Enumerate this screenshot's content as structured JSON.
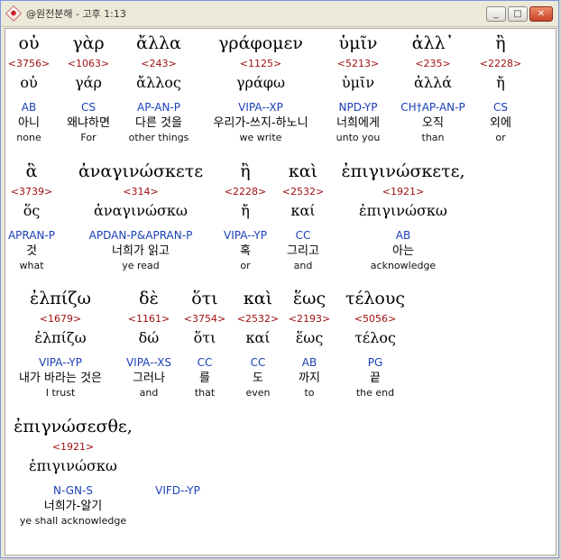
{
  "window": {
    "title": "@원전분해 - 고후 1:13",
    "buttons": {
      "minimize": "_",
      "maximize": "□",
      "close": "✕"
    }
  },
  "rows": [
    {
      "words": [
        {
          "greek": "οὐ",
          "num": "<3756>",
          "lemma": "οὐ",
          "parse": "AB",
          "kor": "아니",
          "eng": "none"
        },
        {
          "greek": "γὰρ",
          "num": "<1063>",
          "lemma": "γάρ",
          "parse": "CS",
          "kor": "왜냐하면",
          "eng": "For"
        },
        {
          "greek": "ἄλλα",
          "num": "<243>",
          "lemma": "ἄλλος",
          "parse": "AP-AN-P",
          "kor": "다른 것을",
          "eng": "other things"
        },
        {
          "greek": "γράφομεν",
          "num": "<1125>",
          "lemma": "γράφω",
          "parse": "VIPA--XP",
          "kor": "우리가-쓰지-하노니",
          "eng": "we write"
        },
        {
          "greek": "ὑμῖν",
          "num": "<5213>",
          "lemma": "ὑμῖν",
          "parse": "NPD-YP",
          "kor": "너희에게",
          "eng": "unto you"
        },
        {
          "greek": "ἀλλ᾽",
          "num": "<235>",
          "lemma": "ἀλλά",
          "parse": "CH†AP-AN-P",
          "kor": "오직",
          "eng": "than"
        },
        {
          "greek": "ἢ",
          "num": "<2228>",
          "lemma": "ἤ",
          "parse": "CS",
          "kor": "외에",
          "eng": "or"
        }
      ]
    },
    {
      "words": [
        {
          "greek": "ἃ",
          "num": "<3739>",
          "lemma": "ὅς",
          "parse": "APRAN-P",
          "kor": "것",
          "eng": "what"
        },
        {
          "greek": "ἀναγινώσκετε",
          "num": "<314>",
          "lemma": "ἀναγινώσκω",
          "parse": "APDAN-P&APRAN-P",
          "kor": "너희가 읽고",
          "eng": "ye read"
        },
        {
          "greek": "ἢ",
          "num": "<2228>",
          "lemma": "ἤ",
          "parse": "VIPA--YP",
          "kor": "혹",
          "eng": "or"
        },
        {
          "greek": "καὶ",
          "num": "<2532>",
          "lemma": "καί",
          "parse": "CC",
          "kor": "그리고",
          "eng": "and"
        },
        {
          "greek": "ἐπιγινώσκετε,",
          "num": "<1921>",
          "lemma": "ἐπιγινώσκω",
          "parse": "AB",
          "kor": "아는",
          "eng": "acknowledge"
        }
      ]
    },
    {
      "words": [
        {
          "greek": "ἐλπίζω",
          "num": "<1679>",
          "lemma": "ἐλπίζω",
          "parse": "VIPA--YP",
          "kor": "내가 바라는 것은",
          "eng": "I trust"
        },
        {
          "greek": "δὲ",
          "num": "<1161>",
          "lemma": "δώ",
          "parse": "VIPA--XS",
          "kor": "그러나",
          "eng": "and"
        },
        {
          "greek": "ὅτι",
          "num": "<3754>",
          "lemma": "ὅτι",
          "parse": "CC",
          "kor": "를",
          "eng": "that"
        },
        {
          "greek": "καὶ",
          "num": "<2532>",
          "lemma": "καί",
          "parse": "CC",
          "kor": "도",
          "eng": "even"
        },
        {
          "greek": "ἕως",
          "num": "<2193>",
          "lemma": "ἕως",
          "parse": "AB",
          "kor": "까지",
          "eng": "to"
        },
        {
          "greek": "τέλους",
          "num": "<5056>",
          "lemma": "τέλος",
          "parse": "PG",
          "kor": "끝",
          "eng": "the end"
        }
      ]
    },
    {
      "words": [
        {
          "greek": "ἐπιγνώσεσθε,",
          "num": "<1921>",
          "lemma": "ἐπιγινώσκω",
          "parse": "N-GN-S",
          "kor": "너희가-알기",
          "eng": "ye shall acknowledge"
        },
        {
          "greek": "",
          "num": "",
          "lemma": "",
          "parse": "VIFD--YP",
          "kor": "",
          "eng": ""
        }
      ]
    }
  ]
}
